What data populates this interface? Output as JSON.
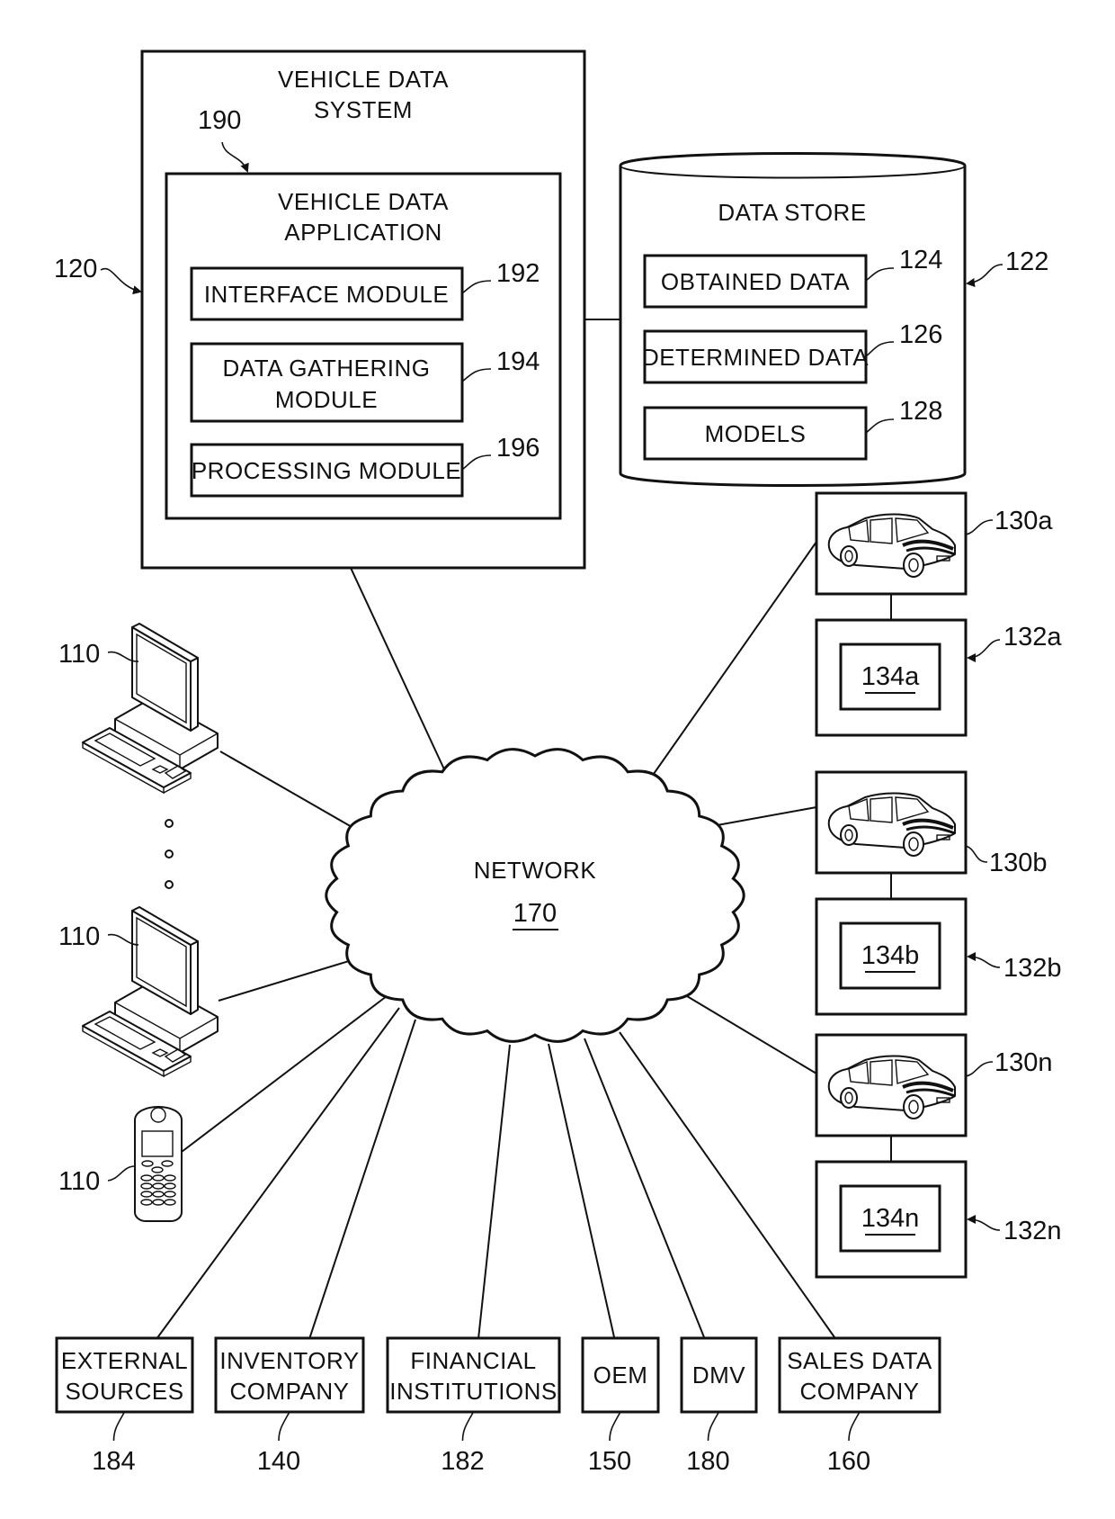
{
  "figure": {
    "vehicle_data_system": {
      "ref": "120",
      "title_lines": [
        "VEHICLE DATA",
        "SYSTEM"
      ],
      "application": {
        "ref": "190",
        "title_lines": [
          "VEHICLE DATA",
          "APPLICATION"
        ],
        "modules": [
          {
            "ref": "192",
            "lines": [
              "INTERFACE MODULE"
            ]
          },
          {
            "ref": "194",
            "lines": [
              "DATA GATHERING",
              "MODULE"
            ]
          },
          {
            "ref": "196",
            "lines": [
              "PROCESSING MODULE"
            ]
          }
        ]
      }
    },
    "data_store": {
      "ref": "122",
      "title": "DATA STORE",
      "items": [
        {
          "ref": "124",
          "label": "OBTAINED DATA"
        },
        {
          "ref": "126",
          "label": "DETERMINED DATA"
        },
        {
          "ref": "128",
          "label": "MODELS"
        }
      ]
    },
    "network": {
      "label": "NETWORK",
      "ref": "170"
    },
    "client_devices": [
      {
        "ref": "110",
        "type": "desktop-computer"
      },
      {
        "ref": "110",
        "type": "desktop-computer"
      },
      {
        "ref": "110",
        "type": "mobile-phone"
      }
    ],
    "vehicles": [
      {
        "vehicle_ref": "130a",
        "device_ref": "132a",
        "component_ref": "134a"
      },
      {
        "vehicle_ref": "130b",
        "device_ref": "132b",
        "component_ref": "134b"
      },
      {
        "vehicle_ref": "130n",
        "device_ref": "132n",
        "component_ref": "134n"
      }
    ],
    "external_entities": [
      {
        "ref": "184",
        "lines": [
          "EXTERNAL",
          "SOURCES"
        ]
      },
      {
        "ref": "140",
        "lines": [
          "INVENTORY",
          "COMPANY"
        ]
      },
      {
        "ref": "182",
        "lines": [
          "FINANCIAL",
          "INSTITUTIONS"
        ]
      },
      {
        "ref": "150",
        "lines": [
          "OEM"
        ]
      },
      {
        "ref": "180",
        "lines": [
          "DMV"
        ]
      },
      {
        "ref": "160",
        "lines": [
          "SALES DATA",
          "COMPANY"
        ]
      }
    ]
  }
}
